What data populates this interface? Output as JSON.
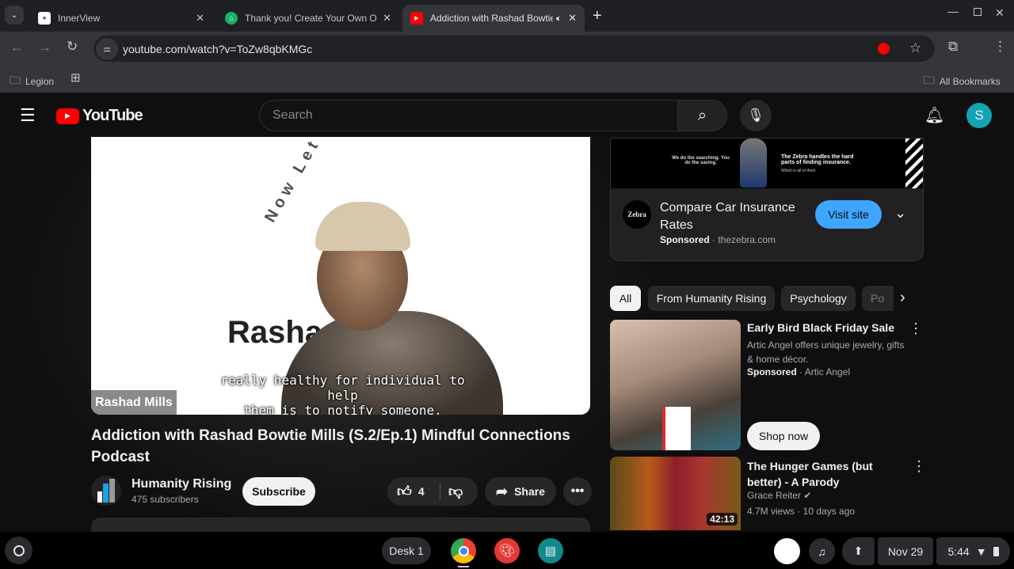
{
  "browser": {
    "tabs": [
      {
        "title": "InnerView"
      },
      {
        "title": "Thank you! Create Your Own Online"
      },
      {
        "title": "Addiction with Rashad Bowtie Mills"
      }
    ],
    "url": "youtube.com/watch?v=ToZw8qbKMGc",
    "bookmarks": {
      "folder": "Legion",
      "all": "All Bookmarks"
    }
  },
  "youtube": {
    "logo": "YouTube",
    "search_placeholder": "Search",
    "avatar_letter": "S"
  },
  "video": {
    "overlay_name": "Rashad Mills",
    "logo_text": "Now Let's Talk",
    "bg_text": "Rashad Mills",
    "caption_line1": "really healthy for individual to help",
    "caption_line2": "them is to notify someone.",
    "title": "Addiction with Rashad Bowtie Mills (S.2/Ep.1) Mindful Connections Podcast",
    "channel": "Humanity Rising",
    "subscribers": "475 subscribers",
    "subscribe_label": "Subscribe",
    "likes": "4",
    "share_label": "Share"
  },
  "ad": {
    "banner_left": "We do the searching. You do the saving.",
    "banner_right": "The Zebra handles the hard parts of finding insurance.",
    "banner_right_small": "Which is all of them.",
    "logo": "Zebra",
    "title": "Compare Car Insurance Rates",
    "sponsored": "Sponsored",
    "domain": "thezebra.com",
    "cta": "Visit site"
  },
  "chips": [
    "All",
    "From Humanity Rising",
    "Psychology",
    "Po"
  ],
  "recs": [
    {
      "title": "Early Bird Black Friday Sale",
      "desc": "Artic Angel offers unique jewelry, gifts & home décor.",
      "sponsored": "Sponsored",
      "advertiser": "Artic Angel",
      "cta": "Shop now"
    },
    {
      "title": "The Hunger Games (but better) - A Parody",
      "channel": "Grace Reiter",
      "meta": "4.7M views · 10 days ago",
      "duration": "42:13"
    }
  ],
  "shelf": {
    "desk": "Desk 1",
    "date": "Nov 29",
    "time": "5:44"
  },
  "colors": {
    "accent": "#3ea6ff",
    "youtube_red": "#ff0000"
  }
}
